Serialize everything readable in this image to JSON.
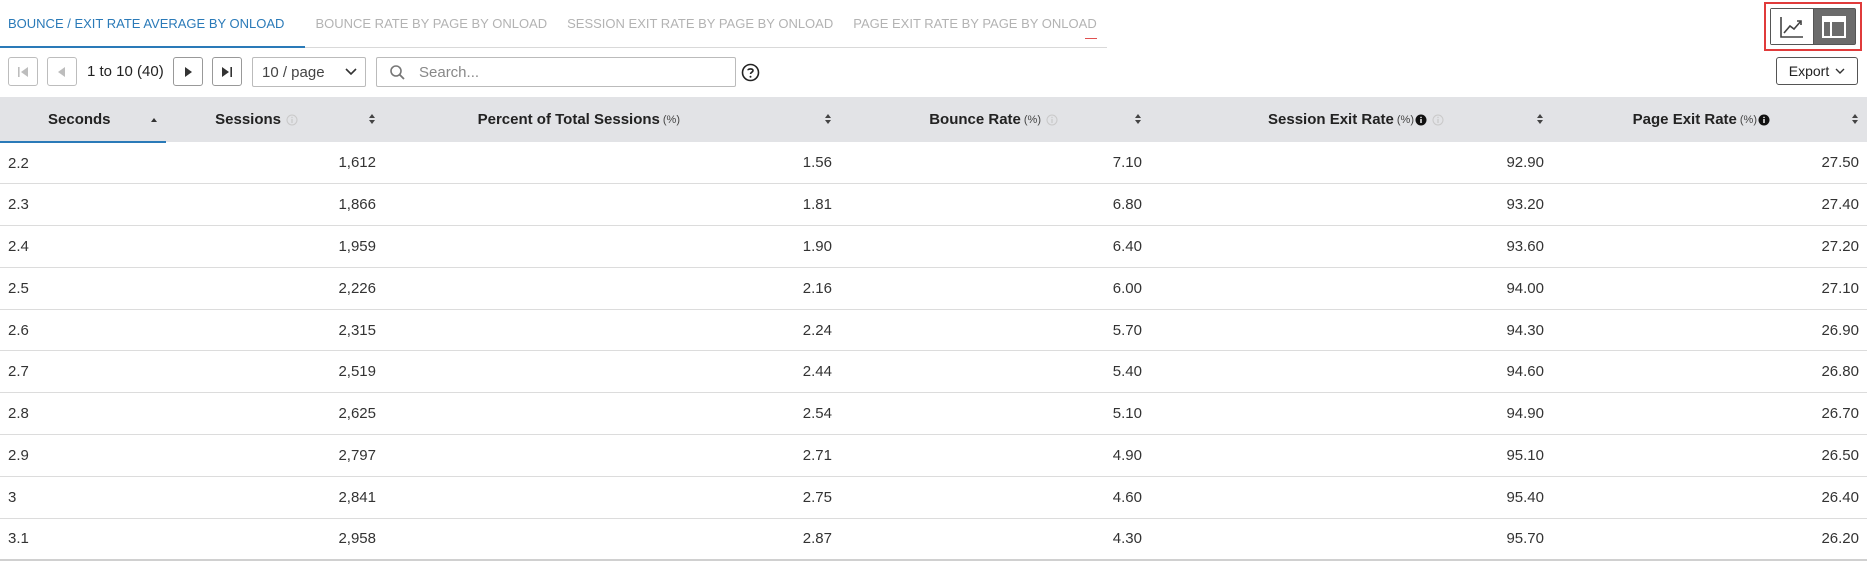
{
  "tabs": [
    {
      "label": "BOUNCE / EXIT RATE AVERAGE BY ONLOAD",
      "active": true
    },
    {
      "label": "BOUNCE RATE BY PAGE BY ONLOAD",
      "active": false
    },
    {
      "label": "SESSION EXIT RATE BY PAGE BY ONLOAD",
      "active": false
    },
    {
      "label": "PAGE EXIT RATE BY PAGE BY ONLOAD",
      "active": false
    }
  ],
  "pagination": {
    "info": "1 to 10 (40)",
    "page_size": "10 / page"
  },
  "search": {
    "placeholder": "Search..."
  },
  "export": {
    "label": "Export"
  },
  "columns": [
    {
      "label": "Seconds",
      "unit": ""
    },
    {
      "label": "Sessions",
      "unit": ""
    },
    {
      "label": "Percent of Total Sessions",
      "unit": "(%)"
    },
    {
      "label": "Bounce Rate",
      "unit": "(%)"
    },
    {
      "label": "Session Exit Rate",
      "unit": "(%)"
    },
    {
      "label": "Page Exit Rate",
      "unit": "(%)"
    }
  ],
  "rows": [
    [
      "2.2",
      "1,612",
      "1.56",
      "7.10",
      "92.90",
      "27.50"
    ],
    [
      "2.3",
      "1,866",
      "1.81",
      "6.80",
      "93.20",
      "27.40"
    ],
    [
      "2.4",
      "1,959",
      "1.90",
      "6.40",
      "93.60",
      "27.20"
    ],
    [
      "2.5",
      "2,226",
      "2.16",
      "6.00",
      "94.00",
      "27.10"
    ],
    [
      "2.6",
      "2,315",
      "2.24",
      "5.70",
      "94.30",
      "26.90"
    ],
    [
      "2.7",
      "2,519",
      "2.44",
      "5.40",
      "94.60",
      "26.80"
    ],
    [
      "2.8",
      "2,625",
      "2.54",
      "5.10",
      "94.90",
      "26.70"
    ],
    [
      "2.9",
      "2,797",
      "2.71",
      "4.90",
      "95.10",
      "26.50"
    ],
    [
      "3",
      "2,841",
      "2.75",
      "4.60",
      "95.40",
      "26.40"
    ],
    [
      "3.1",
      "2,958",
      "2.87",
      "4.30",
      "95.70",
      "26.20"
    ]
  ],
  "colors": {
    "accent": "#2a7ab8",
    "header_bg": "#e2e3e6",
    "highlight": "#e03b3b"
  }
}
